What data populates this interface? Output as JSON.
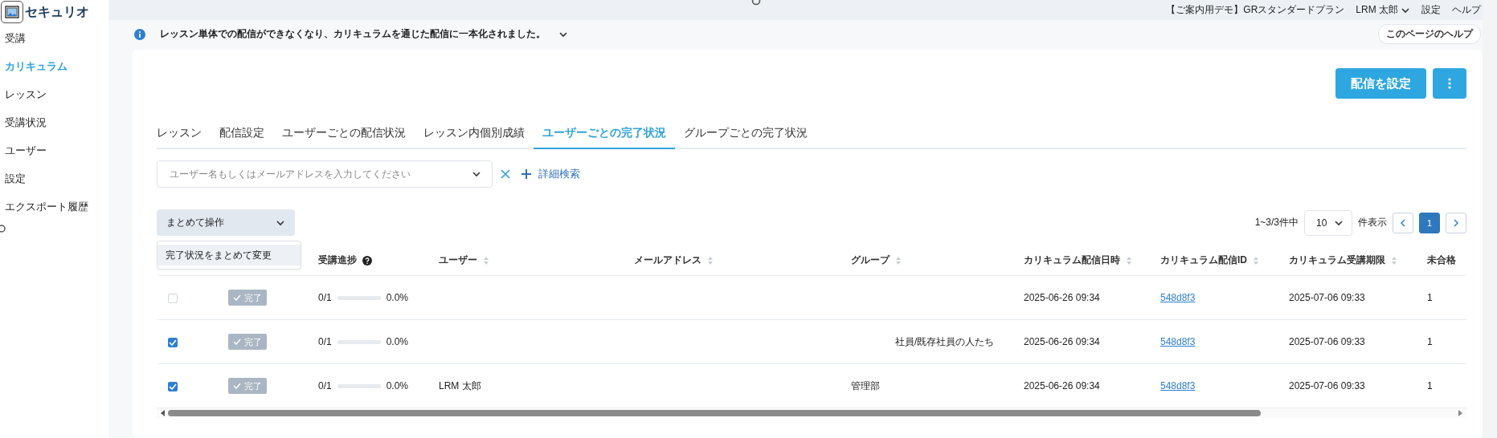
{
  "logo": {
    "text": "セキュリオ"
  },
  "sidebar": {
    "items": [
      {
        "label": "受講",
        "selected": false
      },
      {
        "label": "カリキュラム",
        "selected": true
      },
      {
        "label": "レッスン",
        "selected": false
      },
      {
        "label": "受講状況",
        "selected": false
      },
      {
        "label": "ユーザー",
        "selected": false
      },
      {
        "label": "設定",
        "selected": false
      },
      {
        "label": "エクスポート履歴",
        "selected": false
      }
    ]
  },
  "top_bar": {
    "plan": "【ご案内用デモ】GRスタンダードプラン",
    "user": "LRM 太郎",
    "links": [
      "設定",
      "ヘルプ"
    ]
  },
  "notice": {
    "text": "レッスン単体での配信ができなくなり、カリキュラムを通じた配信に一本化されました。",
    "help_button": "このページのヘルプ"
  },
  "actions": {
    "primary": "配信を設定"
  },
  "tabs": [
    {
      "label": "レッスン",
      "selected": false
    },
    {
      "label": "配信設定",
      "selected": false
    },
    {
      "label": "ユーザーごとの配信状況",
      "selected": false
    },
    {
      "label": "レッスン内個別成績",
      "selected": false
    },
    {
      "label": "ユーザーごとの完了状況",
      "selected": true
    },
    {
      "label": "グループごとの完了状況",
      "selected": false
    }
  ],
  "search": {
    "placeholder": "ユーザー名もしくはメールアドレスを入力してください",
    "advanced": "詳細検索"
  },
  "bulk": {
    "label": "まとめて操作",
    "menu": [
      "完了状況をまとめて変更"
    ]
  },
  "pagination": {
    "range": "1~3/3件中",
    "page_size": "10",
    "per_page_label": "件表示",
    "pages": [
      {
        "label": "1",
        "selected": true
      }
    ]
  },
  "table": {
    "columns": [
      {
        "label": "受講進捗",
        "kind": "help"
      },
      {
        "label": "ユーザー",
        "kind": "sortable"
      },
      {
        "label": "メールアドレス",
        "kind": "sortable"
      },
      {
        "label": "グループ",
        "kind": "sortable"
      },
      {
        "label": "カリキュラム配信日時",
        "kind": "sortable"
      },
      {
        "label": "カリキュラム配信ID",
        "kind": "sortable"
      },
      {
        "label": "カリキュラム受講期限",
        "kind": "sortable"
      },
      {
        "label": "未合格",
        "kind": "plain"
      }
    ],
    "rows": [
      {
        "checked": false,
        "status": "完了",
        "progress": "0/1",
        "level": 0,
        "percent": "0.0%",
        "delivered": "2025-06-26 09:34",
        "id": "548d8f3",
        "deadline": "2025-07-06 09:33",
        "failed": "1"
      },
      {
        "checked": true,
        "status": "完了",
        "progress": "0/1",
        "level": 0,
        "percent": "0.0%",
        "group": "社員/既存社員の人たち",
        "delivered": "2025-06-26 09:34",
        "id": "548d8f3",
        "deadline": "2025-07-06 09:33",
        "failed": "1"
      },
      {
        "checked": true,
        "status": "完了",
        "progress": "0/1",
        "level": 0,
        "percent": "0.0%",
        "user": "LRM 太郎",
        "group": "管理部",
        "delivered": "2025-06-26 09:34",
        "id": "548d8f3",
        "deadline": "2025-07-06 09:33",
        "failed": "1"
      }
    ]
  }
}
